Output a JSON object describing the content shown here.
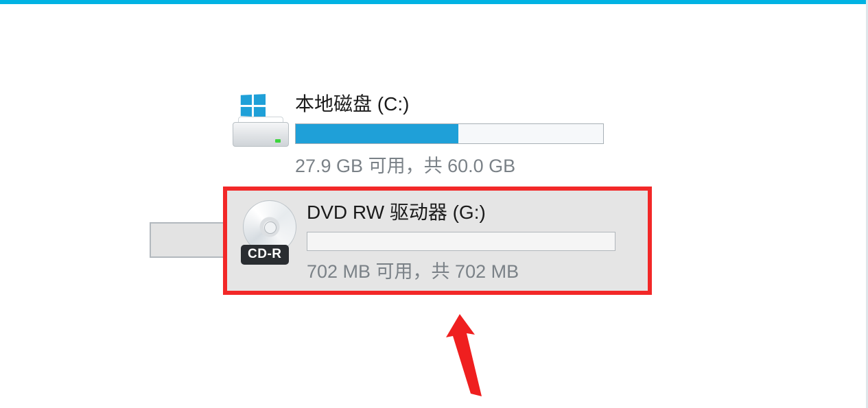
{
  "drives": {
    "c": {
      "name": "本地磁盘 (C:)",
      "detail": "27.9 GB 可用，共 60.0 GB",
      "used_percent": 53
    },
    "g": {
      "name": "DVD RW 驱动器 (G:)",
      "detail": "702 MB 可用，共 702 MB",
      "badge": "CD-R",
      "used_percent": 0
    }
  }
}
